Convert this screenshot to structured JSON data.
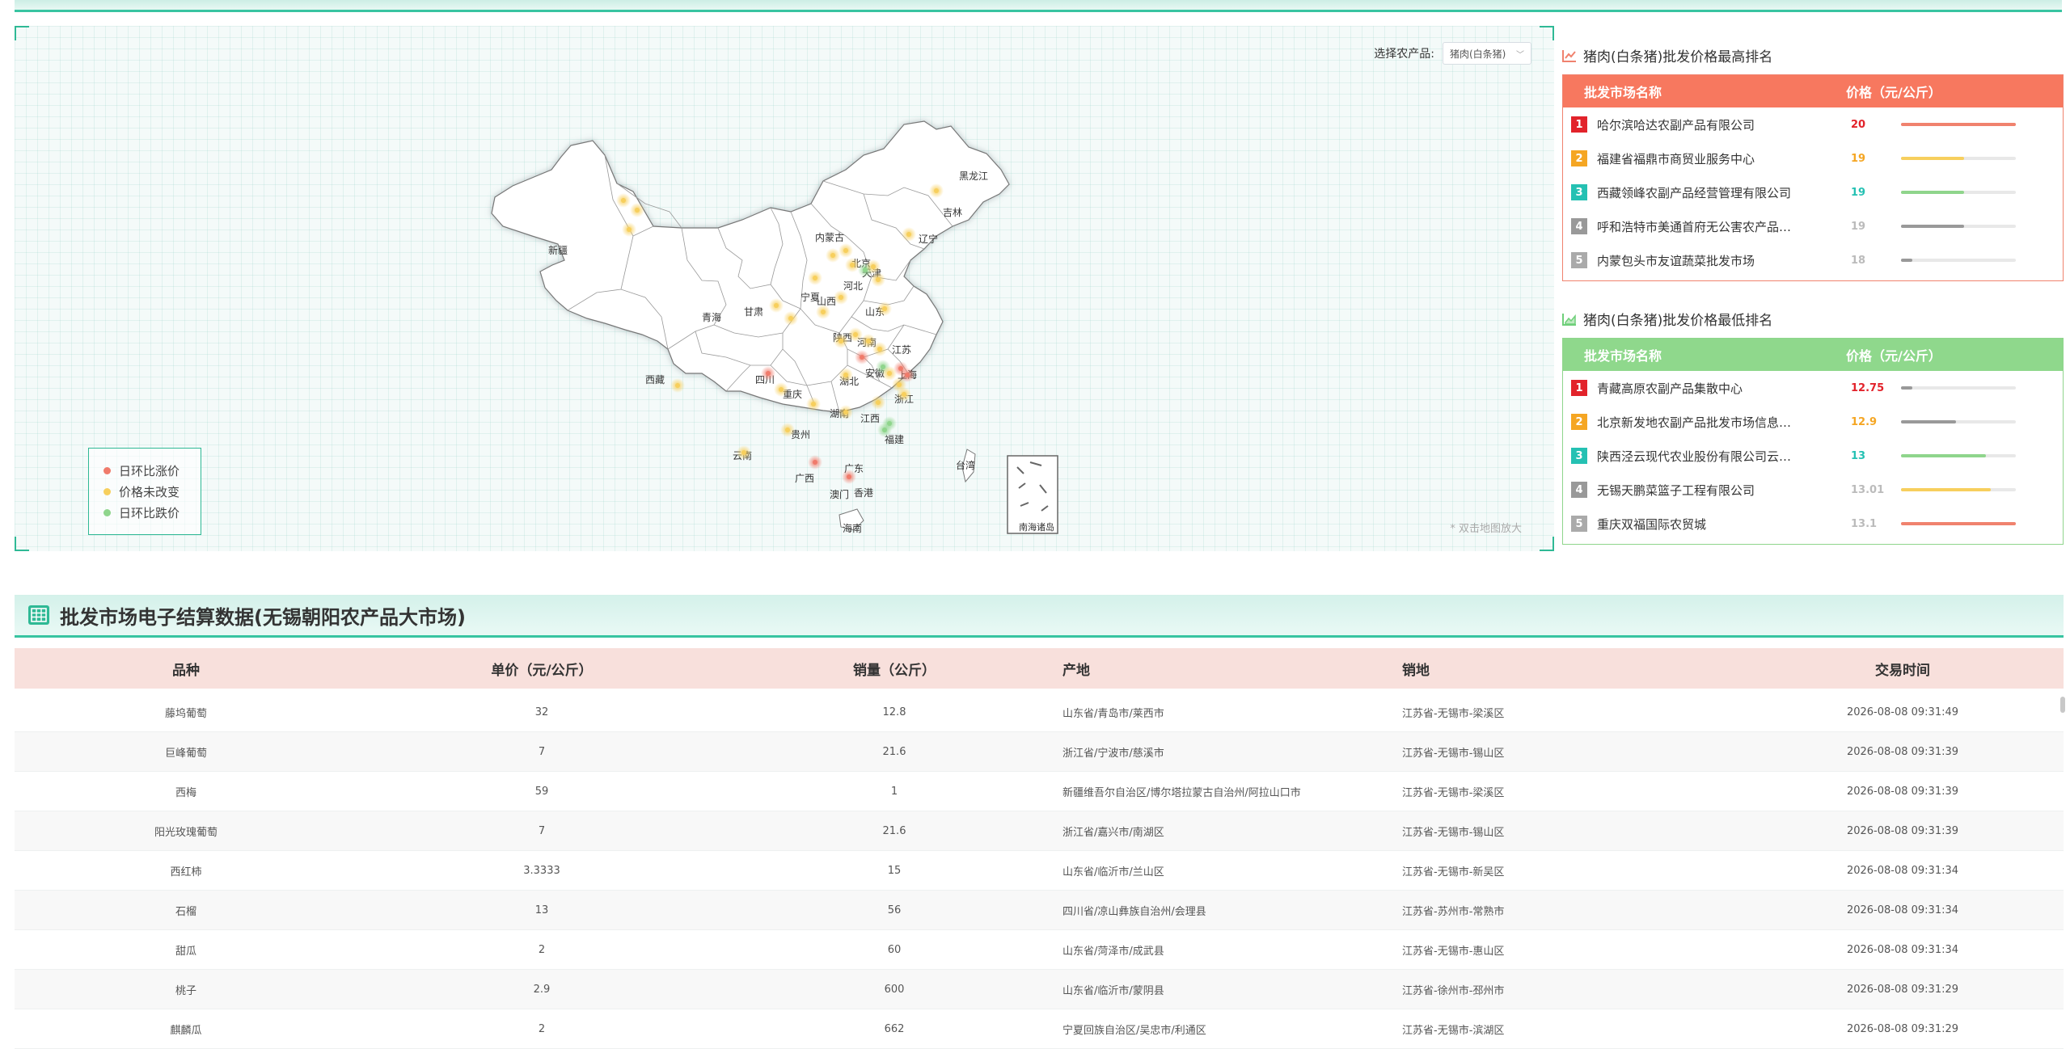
{
  "map": {
    "select_label": "选择农产品:",
    "select_value": "猪肉(白条猪)",
    "hint": "* 双击地图放大",
    "legend": [
      {
        "label": "日环比涨价",
        "color": "#f07b6b"
      },
      {
        "label": "价格未改变",
        "color": "#f7cf5d"
      },
      {
        "label": "日环比跌价",
        "color": "#8fd58c"
      }
    ],
    "provinces": [
      "黑龙江",
      "吉林",
      "辽宁",
      "内蒙古",
      "北京",
      "天津",
      "河北",
      "山西",
      "山东",
      "新疆",
      "甘肃",
      "宁夏",
      "陕西",
      "河南",
      "江苏",
      "青海",
      "西藏",
      "四川",
      "重庆",
      "湖北",
      "安徽",
      "上海",
      "浙江",
      "湖南",
      "江西",
      "贵州",
      "福建",
      "云南",
      "广西",
      "广东",
      "台湾",
      "香港",
      "澳门",
      "海南",
      "南海诸岛"
    ]
  },
  "rank_high": {
    "title": "猪肉(白条猪)批发价格最高排名",
    "col_name": "批发市场名称",
    "col_price": "价格（元/公斤）",
    "rows": [
      {
        "rank": "1",
        "name": "哈尔滨哈达农副产品有限公司",
        "price": "20",
        "fill": 1.0,
        "rank_color": "#e2232b",
        "price_color": "#e2232b",
        "bar_color": "#f0826e"
      },
      {
        "rank": "2",
        "name": "福建省福鼎市商贸业服务中心",
        "price": "19",
        "fill": 0.55,
        "rank_color": "#f5a623",
        "price_color": "#f5a623",
        "bar_color": "#f7cf5d"
      },
      {
        "rank": "3",
        "name": "西藏领峰农副产品经营管理有限公司",
        "price": "19",
        "fill": 0.55,
        "rank_color": "#25c1b3",
        "price_color": "#25c1b3",
        "bar_color": "#8fd58c"
      },
      {
        "rank": "4",
        "name": "呼和浩特市美通首府无公害农产品…",
        "price": "19",
        "fill": 0.55,
        "rank_color": "#999999",
        "price_color": "#bbbbbb",
        "bar_color": "#999999"
      },
      {
        "rank": "5",
        "name": "内蒙包头市友谊蔬菜批发市场",
        "price": "18",
        "fill": 0.1,
        "rank_color": "#aaaaaa",
        "price_color": "#bbbbbb",
        "bar_color": "#999999"
      }
    ]
  },
  "rank_low": {
    "title": "猪肉(白条猪)批发价格最低排名",
    "col_name": "批发市场名称",
    "col_price": "价格（元/公斤）",
    "rows": [
      {
        "rank": "1",
        "name": "青藏高原农副产品集散中心",
        "price": "12.75",
        "fill": 0.1,
        "rank_color": "#e2232b",
        "price_color": "#e2232b",
        "bar_color": "#999999"
      },
      {
        "rank": "2",
        "name": "北京新发地农副产品批发市场信息…",
        "price": "12.9",
        "fill": 0.48,
        "rank_color": "#f5a623",
        "price_color": "#f5a623",
        "bar_color": "#999999"
      },
      {
        "rank": "3",
        "name": "陕西泾云现代农业股份有限公司云…",
        "price": "13",
        "fill": 0.74,
        "rank_color": "#25c1b3",
        "price_color": "#25c1b3",
        "bar_color": "#8fd58c"
      },
      {
        "rank": "4",
        "name": "无锡天鹏菜篮子工程有限公司",
        "price": "13.01",
        "fill": 0.78,
        "rank_color": "#999999",
        "price_color": "#bbbbbb",
        "bar_color": "#f7cf5d"
      },
      {
        "rank": "5",
        "name": "重庆双福国际农贸城",
        "price": "13.1",
        "fill": 1.0,
        "rank_color": "#aaaaaa",
        "price_color": "#bbbbbb",
        "bar_color": "#f0826e"
      }
    ]
  },
  "settlement": {
    "title": "批发市场电子结算数据(无锡朝阳农产品大市场)",
    "headers": {
      "variety": "品种",
      "price": "单价（元/公斤）",
      "volume": "销量（公斤）",
      "origin": "产地",
      "dest": "销地",
      "time": "交易时间"
    },
    "rows": [
      {
        "variety": "藤坞葡萄",
        "price": "32",
        "volume": "12.8",
        "origin": "山东省/青岛市/莱西市",
        "dest": "江苏省-无锡市-梁溪区",
        "time": "2026-08-08 09:31:49"
      },
      {
        "variety": "巨峰葡萄",
        "price": "7",
        "volume": "21.6",
        "origin": "浙江省/宁波市/慈溪市",
        "dest": "江苏省-无锡市-锡山区",
        "time": "2026-08-08 09:31:39"
      },
      {
        "variety": "西梅",
        "price": "59",
        "volume": "1",
        "origin": "新疆维吾尔自治区/博尔塔拉蒙古自治州/阿拉山口市",
        "dest": "江苏省-无锡市-梁溪区",
        "time": "2026-08-08 09:31:39"
      },
      {
        "variety": "阳光玫瑰葡萄",
        "price": "7",
        "volume": "21.6",
        "origin": "浙江省/嘉兴市/南湖区",
        "dest": "江苏省-无锡市-锡山区",
        "time": "2026-08-08 09:31:39"
      },
      {
        "variety": "西红柿",
        "price": "3.3333",
        "volume": "15",
        "origin": "山东省/临沂市/兰山区",
        "dest": "江苏省-无锡市-新吴区",
        "time": "2026-08-08 09:31:34"
      },
      {
        "variety": "石榴",
        "price": "13",
        "volume": "56",
        "origin": "四川省/凉山彝族自治州/会理县",
        "dest": "江苏省-苏州市-常熟市",
        "time": "2026-08-08 09:31:34"
      },
      {
        "variety": "甜瓜",
        "price": "2",
        "volume": "60",
        "origin": "山东省/菏泽市/成武县",
        "dest": "江苏省-无锡市-惠山区",
        "time": "2026-08-08 09:31:34"
      },
      {
        "variety": "桃子",
        "price": "2.9",
        "volume": "600",
        "origin": "山东省/临沂市/蒙阴县",
        "dest": "江苏省-徐州市-邳州市",
        "time": "2026-08-08 09:31:29"
      },
      {
        "variety": "麒麟瓜",
        "price": "2",
        "volume": "662",
        "origin": "宁夏回族自治区/吴忠市/利通区",
        "dest": "江苏省-无锡市-滨湖区",
        "time": "2026-08-08 09:31:29"
      }
    ]
  }
}
